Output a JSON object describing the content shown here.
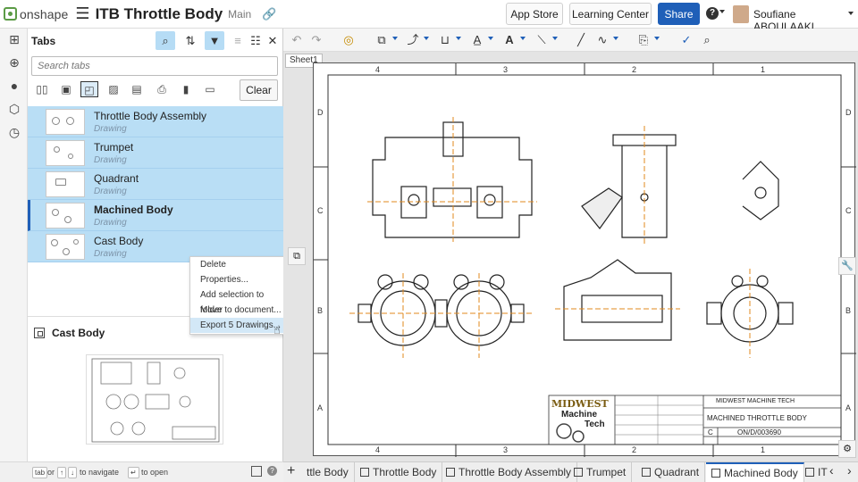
{
  "app": {
    "logo_text": "onshape",
    "document_title": "ITB Throttle Body",
    "branch": "Main"
  },
  "topbar": {
    "app_store": "App Store",
    "learning_center": "Learning Center",
    "share": "Share",
    "help": "?",
    "user_name": "Soufiane ABOULAAKL"
  },
  "tabs_panel": {
    "title": "Tabs",
    "search_placeholder": "Search tabs",
    "clear_label": "Clear",
    "items": [
      {
        "name": "Throttle Body Assembly",
        "type": "Drawing"
      },
      {
        "name": "Trumpet",
        "type": "Drawing"
      },
      {
        "name": "Quadrant",
        "type": "Drawing"
      },
      {
        "name": "Machined Body",
        "type": "Drawing",
        "current": true
      },
      {
        "name": "Cast Body",
        "type": "Drawing"
      }
    ],
    "preview_title": "Cast Body"
  },
  "context_menu": [
    "Delete",
    "Properties...",
    "Add selection to folder",
    "Move to document...",
    "Export 5 Drawings..."
  ],
  "status_bar": {
    "tab_key": "tab",
    "or": "or",
    "up": "↑",
    "down": "↓",
    "navigate": "to navigate",
    "enter_key": "↵",
    "open": "to open"
  },
  "canvas": {
    "sheet_label": "Sheet1",
    "zone_columns": [
      "4",
      "3",
      "2",
      "1"
    ],
    "zone_rows": [
      "D",
      "C",
      "B",
      "A"
    ],
    "title_block": {
      "company": "MIDWEST MACHINE TECH",
      "title": "MACHINED THROTTLE BODY",
      "size": "C",
      "number": "ON/D/003690",
      "logo_line1": "MIDWEST",
      "logo_line2": "Machine",
      "logo_line3": "Tech"
    }
  },
  "bottom_tabs": [
    {
      "label": "ttle Body",
      "partial": true
    },
    {
      "label": "Throttle Body"
    },
    {
      "label": "Throttle Body Assembly"
    },
    {
      "label": "Trumpet"
    },
    {
      "label": "Quadrant"
    },
    {
      "label": "Machined Body",
      "active": true
    },
    {
      "label": "IT",
      "partial": true
    }
  ],
  "colors": {
    "accent": "#1f5fb8",
    "selection": "#b9def5",
    "logo_green": "#5b9b45",
    "orange_line": "#e08a1e"
  }
}
